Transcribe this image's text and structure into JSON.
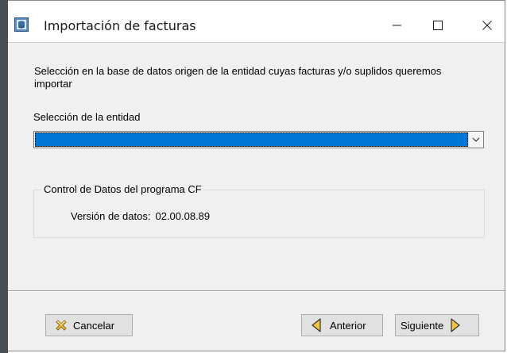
{
  "window": {
    "title": "Importación de facturas",
    "icon": "database-app-icon",
    "controls": [
      "minimize-icon",
      "maximize-icon",
      "close-icon"
    ]
  },
  "content": {
    "description": "Selección en la base de datos origen de la entidad cuyas facturas y/o suplidos queremos importar",
    "entity_label": "Selección de la entidad",
    "entity_value": "",
    "data_control": {
      "legend": "Control de Datos del programa CF",
      "version_label": "Versión de datos:",
      "version_value": "02.00.08.89"
    }
  },
  "buttons": {
    "cancel": "Cancelar",
    "back": "Anterior",
    "next": "Siguiente"
  },
  "colors": {
    "selection": "#0078d7",
    "dialog_bg": "#f0f0f0",
    "button_bg": "#e1e1e1"
  }
}
